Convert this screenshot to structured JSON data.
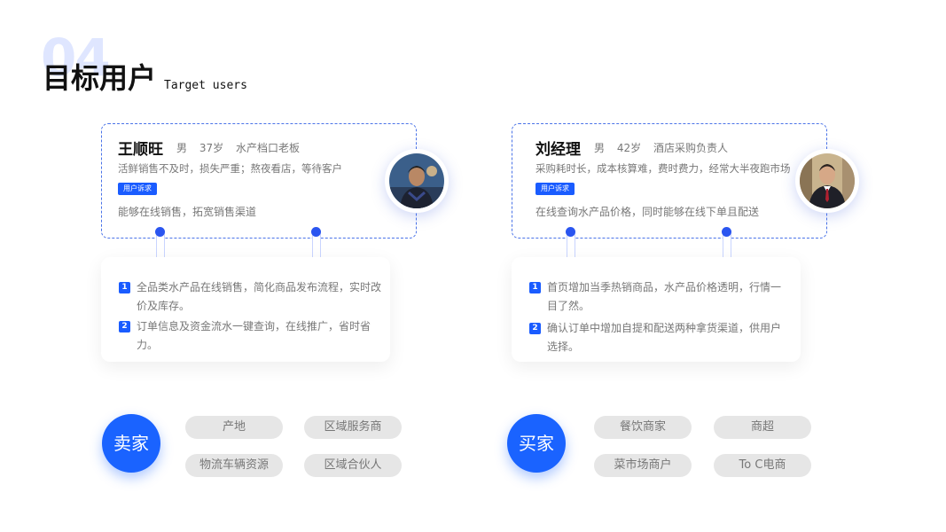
{
  "header": {
    "number": "04",
    "title": "目标用户",
    "subtitle": "Target users"
  },
  "personas": [
    {
      "name": "王顺旺",
      "gender": "男",
      "age": "37岁",
      "role": "水产档口老板",
      "pain": "活鲜销售不及时，损失严重；熬夜看店，等待客户",
      "tag": "用户诉求",
      "need": "能够在线销售，拓宽销售渠道",
      "points": [
        {
          "num": "1",
          "text": "全品类水产品在线销售，简化商品发布流程，实时改价及库存。"
        },
        {
          "num": "2",
          "text": "订单信息及资金流水一键查询，在线推广，省时省力。"
        }
      ]
    },
    {
      "name": "刘经理",
      "gender": "男",
      "age": "42岁",
      "role": "酒店采购负责人",
      "pain": "采购耗时长，成本核算难，费时费力，经常大半夜跑市场",
      "tag": "用户诉求",
      "need": "在线查询水产品价格，同时能够在线下单且配送",
      "points": [
        {
          "num": "1",
          "text": "首页增加当季热销商品，水产品价格透明，行情一目了然。"
        },
        {
          "num": "2",
          "text": "确认订单中增加自提和配送两种拿货渠道，供用户选择。"
        }
      ]
    }
  ],
  "groups": [
    {
      "role": "卖家",
      "pills": [
        "产地",
        "区域服务商",
        "物流车辆资源",
        "区域合伙人"
      ]
    },
    {
      "role": "买家",
      "pills": [
        "餐饮商家",
        "商超",
        "菜市场商户",
        "To C电商"
      ]
    }
  ],
  "colors": {
    "accent": "#1a63ff",
    "dashed_border": "#4a73e8",
    "pill_bg": "#e6e6e6"
  }
}
